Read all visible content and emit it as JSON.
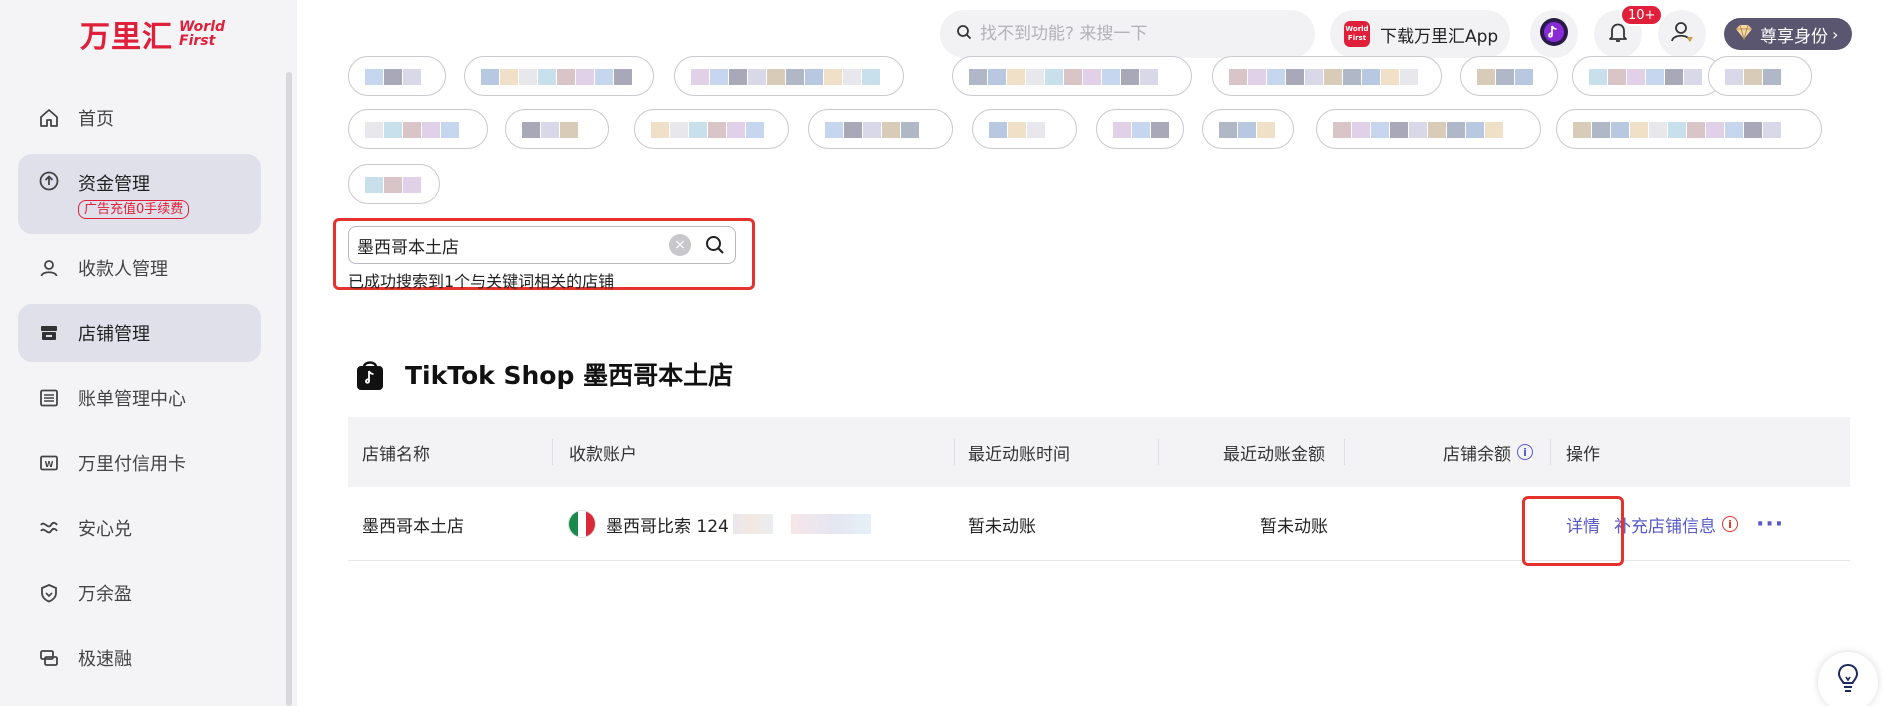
{
  "brand": {
    "name_cn": "万里汇",
    "name_en_line1": "World",
    "name_en_line2": "First"
  },
  "sidebar": {
    "items": [
      {
        "label": "首页",
        "icon": "home-icon"
      },
      {
        "label": "资金管理",
        "icon": "upload-circle-icon",
        "badge": "广告充值0手续费"
      },
      {
        "label": "收款人管理",
        "icon": "user-icon"
      },
      {
        "label": "店铺管理",
        "icon": "store-icon"
      },
      {
        "label": "账单管理中心",
        "icon": "list-icon"
      },
      {
        "label": "万里付信用卡",
        "icon": "card-icon"
      },
      {
        "label": "安心兑",
        "icon": "exchange-icon"
      },
      {
        "label": "万余盈",
        "icon": "shield-icon"
      },
      {
        "label": "极速融",
        "icon": "finance-icon"
      }
    ],
    "active_index": 3
  },
  "topbar": {
    "search_placeholder": "找不到功能? 来搜一下",
    "app_button_label": "下载万里汇App",
    "app_logo_text": "World First",
    "notification_count": "10+",
    "vip_label": "尊享身份"
  },
  "store_search": {
    "value": "墨西哥本土店",
    "result_message": "已成功搜索到1个与关键词相关的店铺"
  },
  "shop": {
    "title": "TikTok Shop 墨西哥本土店",
    "columns": [
      "店铺名称",
      "收款账户",
      "最近动账时间",
      "最近动账金额",
      "店铺余额",
      "操作"
    ],
    "rows": [
      {
        "name": "墨西哥本土店",
        "account": "墨西哥比索 124",
        "last_txn_time": "暂未动账",
        "last_txn_amount": "暂未动账",
        "balance": "",
        "actions": {
          "detail": "详情",
          "supplement": "补充店铺信息",
          "more": "···"
        }
      }
    ]
  },
  "colors": {
    "brand_red": "#e0203a",
    "link": "#5a5ac8",
    "highlight": "#e5322d",
    "active_bg": "#dfe0ea"
  }
}
